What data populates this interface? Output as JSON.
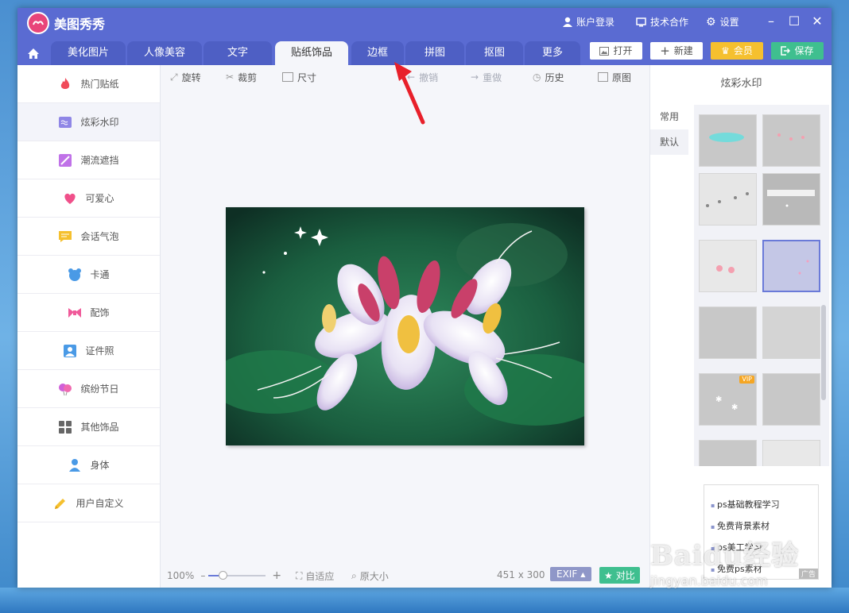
{
  "app": {
    "title": "美图秀秀"
  },
  "titlebar": {
    "login": "账户登录",
    "cooperation": "技术合作",
    "settings": "设置"
  },
  "tabs": [
    "美化图片",
    "人像美容",
    "文字",
    "贴纸饰品",
    "边框",
    "拼图",
    "抠图",
    "更多"
  ],
  "active_tab": "贴纸饰品",
  "actions": {
    "open": "打开",
    "new": "新建",
    "vip": "会员",
    "save": "保存"
  },
  "sidebar": {
    "items": [
      {
        "label": "热门贴纸",
        "icon": "fire-icon",
        "color": "#f04a5a"
      },
      {
        "label": "炫彩水印",
        "icon": "watermark-icon",
        "color": "#8f86e6"
      },
      {
        "label": "潮流遮挡",
        "icon": "pen-block-icon",
        "color": "#c072e8"
      },
      {
        "label": "可爱心",
        "icon": "heart-icon",
        "color": "#f0508a"
      },
      {
        "label": "会话气泡",
        "icon": "chat-bubble-icon",
        "color": "#f5c02e"
      },
      {
        "label": "卡通",
        "icon": "bear-icon",
        "color": "#4a9ae6"
      },
      {
        "label": "配饰",
        "icon": "bow-icon",
        "color": "#f05a9a"
      },
      {
        "label": "证件照",
        "icon": "id-photo-icon",
        "color": "#4a9ae6"
      },
      {
        "label": "缤纷节日",
        "icon": "balloon-icon",
        "color": "#d060d8"
      },
      {
        "label": "其他饰品",
        "icon": "grid-icon",
        "color": "#666666"
      },
      {
        "label": "身体",
        "icon": "person-icon",
        "color": "#4a9ae6"
      },
      {
        "label": "用户自定义",
        "icon": "pencil-icon",
        "color": "#f5c02e"
      }
    ]
  },
  "sidebar_active": "炫彩水印",
  "toolbar": {
    "rotate": "旋转",
    "crop": "裁剪",
    "size": "尺寸",
    "undo": "撤销",
    "redo": "重做",
    "history": "历史",
    "original": "原图"
  },
  "bottom": {
    "zoom": "100%",
    "zoom_level": 0.25,
    "fit": "自适应",
    "actual": "原大小",
    "dimensions": "451 x 300",
    "exif": "EXIF",
    "compare": "对比"
  },
  "panel": {
    "title": "炫彩水印",
    "tabs": [
      "常用",
      "默认"
    ],
    "active_tab": "默认",
    "vip_badge": "VIP"
  },
  "ad": {
    "lines": [
      "ps基础教程学习",
      "免费背景素材",
      "ps美工学习",
      "免费ps素材"
    ],
    "tag": "广告"
  },
  "watermark": {
    "text": "Baidu经验",
    "url": "jingyan.baidu.com"
  },
  "colors": {
    "titlebar": "#5a6bd2",
    "accent": "#6a7ad8",
    "vip": "#f5c02e",
    "save": "#3fbf8f",
    "arrow": "#e8202a"
  }
}
